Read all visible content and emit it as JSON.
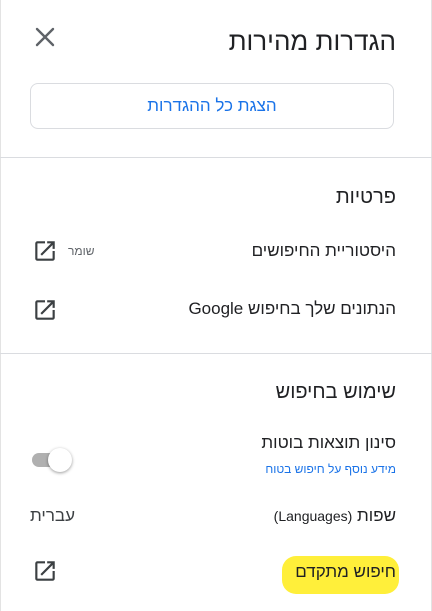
{
  "header": {
    "title": "הגדרות מהירות",
    "close_icon": "close-icon"
  },
  "see_all_button": {
    "label": "הצגת כל ההגדרות"
  },
  "privacy": {
    "heading": "פרטיות",
    "search_history": {
      "label": "היסטוריית החיפושים",
      "status": "שומר",
      "icon": "open-in-new-icon"
    },
    "your_data": {
      "label": "הנתונים שלך בחיפוש Google",
      "icon": "open-in-new-icon"
    }
  },
  "search_usage": {
    "heading": "שימוש בחיפוש",
    "safesearch": {
      "label": "סינון תוצאות בוטות",
      "learn_more": "מידע נוסף על חיפוש בטוח",
      "enabled": false
    },
    "languages": {
      "label": "שפות",
      "label_en": "(Languages)",
      "value": "עברית"
    },
    "advanced_search": {
      "label": "חיפוש מתקדם",
      "icon": "open-in-new-icon",
      "highlight_color": "#ffef3a"
    }
  },
  "colors": {
    "accent": "#1a73e8",
    "text": "#202124",
    "secondary": "#5f6368"
  }
}
